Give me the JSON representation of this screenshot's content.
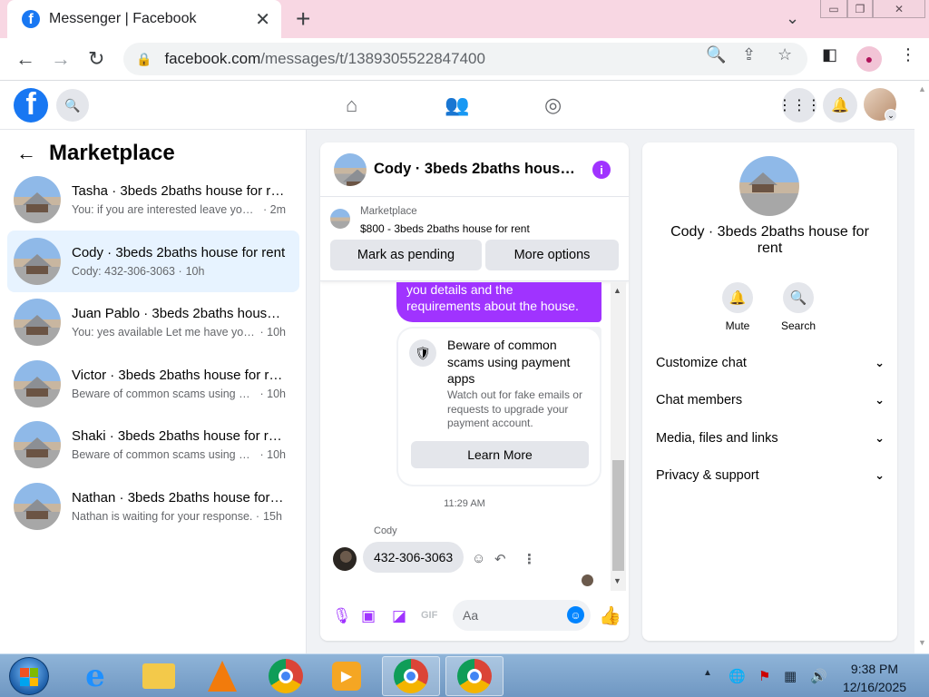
{
  "browser": {
    "tab_title": "Messenger | Facebook",
    "url_domain": "facebook.com",
    "url_path": "/messages/t/1389305522847400"
  },
  "marketplace": {
    "title": "Marketplace",
    "conversations": [
      {
        "name": "Tasha · 3beds 2baths house for rent",
        "preview": "You: if you are interested leave your ...",
        "time": "· 2m"
      },
      {
        "name": "Cody · 3beds 2baths house for rent",
        "preview": "Cody: 432-306-3063 ·",
        "time": "10h",
        "active": true
      },
      {
        "name": "Juan Pablo · 3beds 2baths house f...",
        "preview": "You: yes available Let me have your c...",
        "time": "· 10h"
      },
      {
        "name": "Victor · 3beds 2baths house for rent",
        "preview": "Beware of common scams using pay...",
        "time": "· 10h"
      },
      {
        "name": "Shaki · 3beds 2baths house for rent",
        "preview": "Beware of common scams using pay...",
        "time": "· 10h"
      },
      {
        "name": "Nathan · 3beds 2baths house for r...",
        "preview": "Nathan is waiting for your response. ·",
        "time": "15h"
      }
    ]
  },
  "chat": {
    "title": "Cody · 3beds 2baths house f...",
    "listing_label": "Marketplace",
    "listing_price_title": "$800 - 3beds 2baths house for rent",
    "mark_pending": "Mark as pending",
    "more_options": "More options",
    "my_message_tail_1": "you details and the",
    "my_message_tail_2": "requirements about the house.",
    "warning_title": "Beware of common scams using payment apps",
    "warning_body": "Watch out for fake emails or requests to upgrade your payment account.",
    "learn_more": "Learn More",
    "timestamp": "11:29 AM",
    "sender": "Cody",
    "their_message": "432-306-3063",
    "composer_placeholder": "Aa"
  },
  "info_panel": {
    "title": "Cody · 3beds 2baths house for rent",
    "mute": "Mute",
    "search": "Search",
    "sections": [
      "Customize chat",
      "Chat members",
      "Media, files and links",
      "Privacy & support"
    ]
  },
  "taskbar": {
    "time": "9:38 PM",
    "date": "12/16/2025"
  },
  "colors": {
    "messenger_purple": "#a033ff",
    "facebook_blue": "#1877f2",
    "active_row": "#e7f3ff"
  }
}
